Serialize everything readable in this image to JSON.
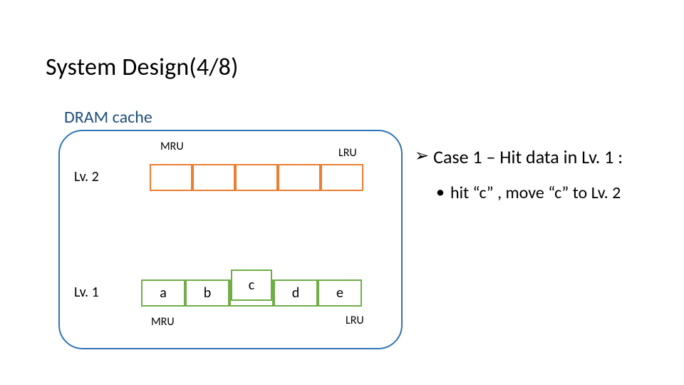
{
  "title": "System Design(4/8)",
  "subtitle": "DRAM cache",
  "labels": {
    "mru": "MRU",
    "lru": "LRU",
    "lv2": "Lv. 2",
    "lv1": "Lv. 1"
  },
  "rows": {
    "lv2": [
      "",
      "",
      "",
      "",
      ""
    ],
    "lv1": [
      "a",
      "b",
      "c",
      "d",
      "e"
    ]
  },
  "highlighted_cell": "c",
  "case_text": "Case 1 – Hit data in Lv. 1 :",
  "hit_text": "hit “c” , move “c” to Lv. 2",
  "glyphs": {
    "arrow": "➢",
    "bullet": "•"
  },
  "chart_data": {
    "type": "diagram",
    "description": "Two-level DRAM cache. Each level is a 5-slot row ordered MRU→LRU.",
    "levels": [
      {
        "name": "Lv. 2",
        "mru_to_lru": [
          "",
          "",
          "",
          "",
          ""
        ]
      },
      {
        "name": "Lv. 1",
        "mru_to_lru": [
          "a",
          "b",
          "c",
          "d",
          "e"
        ]
      }
    ],
    "event": {
      "case": 1,
      "action": "hit",
      "key": "c",
      "from_level": "Lv. 1",
      "promote_to": "Lv. 2"
    }
  }
}
